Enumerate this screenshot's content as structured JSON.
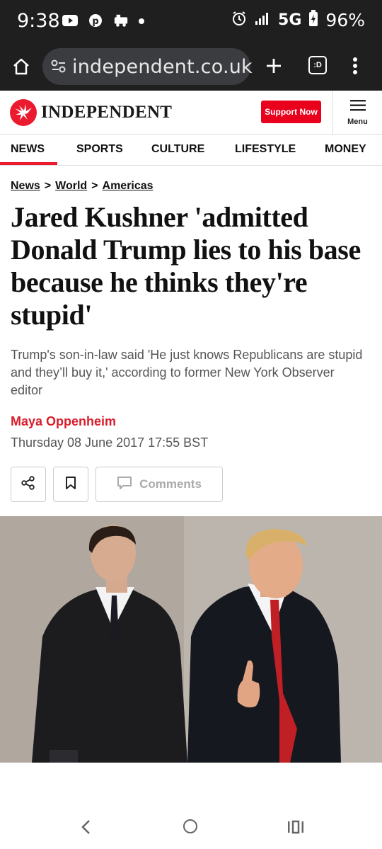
{
  "status_bar": {
    "time": "9:38",
    "network": "5G",
    "battery": "96%"
  },
  "browser": {
    "url": "independent.co.uk",
    "tabs_icon_text": ":D"
  },
  "site": {
    "logo_text": "INDEPENDENT",
    "support_label": "Support Now",
    "menu_label": "Menu",
    "brand_color": "#ec1a2e"
  },
  "nav": {
    "items": [
      "NEWS",
      "SPORTS",
      "CULTURE",
      "LIFESTYLE",
      "MONEY"
    ]
  },
  "article": {
    "breadcrumb": [
      "News",
      "World",
      "Americas"
    ],
    "breadcrumb_separator": ">",
    "headline": "Jared Kushner 'admitted Donald Trump lies to his base because he thinks they're stupid'",
    "standfirst": "Trump's son-in-law said 'He just knows Republicans are stupid and they’ll buy it,' according to former New York Observer editor",
    "author": "Maya Oppenheim",
    "date": "Thursday 08 June 2017 17:55 BST",
    "comments_label": "Comments"
  }
}
